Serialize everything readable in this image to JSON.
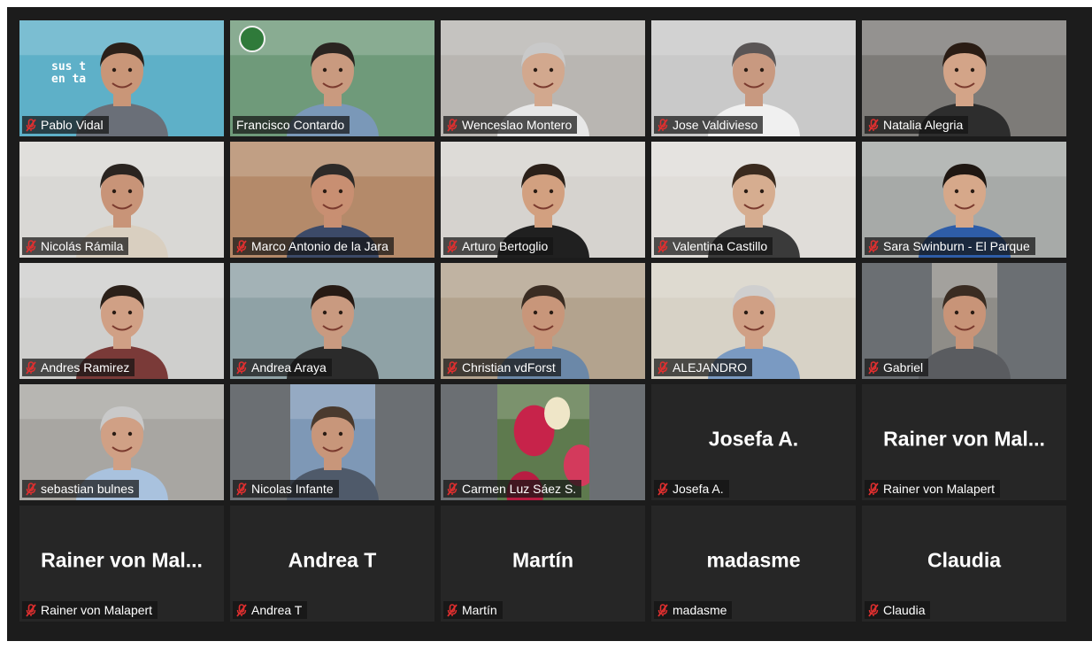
{
  "participants": [
    {
      "name": "Pablo Vidal",
      "muted": true,
      "video": true,
      "bg": "#5eb0c8",
      "skin": "#c99678",
      "shirt": "#6a6f78",
      "hair": "#2b2019",
      "brand_text": "sus ten ta"
    },
    {
      "name": "Francisco Contardo",
      "muted": false,
      "video": true,
      "active": true,
      "bg": "#6f9a7a",
      "skin": "#c99a7f",
      "shirt": "#7a98b8",
      "hair": "#2a2420"
    },
    {
      "name": "Wenceslao Montero",
      "muted": true,
      "video": true,
      "bg": "#b9b6b2",
      "skin": "#d2a88e",
      "shirt": "#e7e7e7",
      "hair": "#c9c9c9"
    },
    {
      "name": "Jose Valdivieso",
      "muted": true,
      "video": true,
      "bg": "#c9c9c9",
      "skin": "#c89980",
      "shirt": "#f0f0f0",
      "hair": "#5a5555"
    },
    {
      "name": "Natalia Alegria",
      "muted": true,
      "video": true,
      "bg": "#7d7b78",
      "skin": "#d3a488",
      "shirt": "#2d2d2d",
      "hair": "#2a1c14"
    },
    {
      "name": "Nicolás Rámila",
      "muted": true,
      "video": true,
      "bg": "#d9d8d5",
      "skin": "#c89478",
      "shirt": "#d9cfc0",
      "hair": "#2a2420"
    },
    {
      "name": "Marco Antonio de la Jara",
      "muted": true,
      "video": true,
      "bg": "#b48a6a",
      "skin": "#c88f72",
      "shirt": "#3c4a68",
      "hair": "#2d2a28"
    },
    {
      "name": "Arturo Bertoglio",
      "muted": true,
      "video": true,
      "bg": "#d6d3cf",
      "skin": "#d2a080",
      "shirt": "#202020",
      "hair": "#2b2019"
    },
    {
      "name": "Valentina Castillo",
      "muted": true,
      "video": true,
      "bg": "#e0ddd9",
      "skin": "#d6ad90",
      "shirt": "#3a3a3a",
      "hair": "#3a2a1e"
    },
    {
      "name": "Sara Swinburn - El Parque",
      "muted": true,
      "video": true,
      "bg": "#a7aaa8",
      "skin": "#d6a88a",
      "shirt": "#2e5da8",
      "hair": "#1f1712"
    },
    {
      "name": "Andres Ramirez",
      "muted": true,
      "video": true,
      "bg": "#cfcfcd",
      "skin": "#d0a085",
      "shirt": "#7a3a38",
      "hair": "#2b2019"
    },
    {
      "name": "Andrea Araya",
      "muted": true,
      "video": true,
      "bg": "#8fa2a6",
      "skin": "#c99a80",
      "shirt": "#2b2b2b",
      "hair": "#261a14"
    },
    {
      "name": "Christian vdForst",
      "muted": true,
      "video": true,
      "bg": "#b3a38e",
      "skin": "#c8967a",
      "shirt": "#6b88a8",
      "hair": "#3a2c22"
    },
    {
      "name": "ALEJANDRO",
      "muted": true,
      "video": true,
      "bg": "#d7d2c6",
      "skin": "#d0a085",
      "shirt": "#7a9ac2",
      "hair": "#cfcfcf"
    },
    {
      "name": "Gabriel",
      "muted": true,
      "video": true,
      "inset": true,
      "bg": "#8f8d88",
      "skin": "#c89478",
      "shirt": "#5a5c60",
      "hair": "#3a2c22"
    },
    {
      "name": "sebastian bulnes",
      "muted": true,
      "video": true,
      "bg": "#a8a6a2",
      "skin": "#d0a085",
      "shirt": "#a9c2de",
      "hair": "#c9c9c9"
    },
    {
      "name": "Nicolas Infante",
      "muted": true,
      "video": true,
      "inset": true,
      "bg": "#7e98b6",
      "skin": "#c8967a",
      "shirt": "#4f5a6a",
      "hair": "#4a3a2e"
    },
    {
      "name": "Carmen Luz Sáez S.",
      "muted": true,
      "video": true,
      "inset": true,
      "bg": "#5e7a4e",
      "skin": "#e6e0cc",
      "shirt": "#c7234a",
      "hair": "#2b3a22",
      "flowers": true
    },
    {
      "name": "Josefa A.",
      "muted": true,
      "video": false,
      "display_name": "Josefa A."
    },
    {
      "name": "Rainer von Malapert",
      "muted": true,
      "video": false,
      "display_name": "Rainer von Mal..."
    },
    {
      "name": "Rainer von Malapert",
      "muted": true,
      "video": false,
      "display_name": "Rainer von Mal..."
    },
    {
      "name": "Andrea T",
      "muted": true,
      "video": false,
      "display_name": "Andrea T"
    },
    {
      "name": "Martín",
      "muted": true,
      "video": false,
      "display_name": "Martín"
    },
    {
      "name": "madasme",
      "muted": true,
      "video": false,
      "display_name": "madasme"
    },
    {
      "name": "Claudia",
      "muted": true,
      "video": false,
      "display_name": "Claudia"
    }
  ],
  "icons": {
    "muted": "mic-muted-icon"
  },
  "colors": {
    "active_speaker_border": "#d8e04a",
    "mute_icon": "#e02f2f",
    "tile_empty": "#262626",
    "window_bg": "#1c1c1c"
  }
}
